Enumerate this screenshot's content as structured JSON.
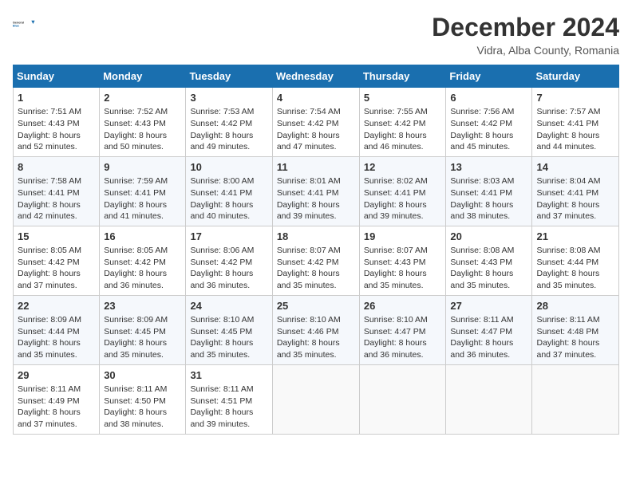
{
  "header": {
    "logo_general": "General",
    "logo_blue": "Blue",
    "main_title": "December 2024",
    "subtitle": "Vidra, Alba County, Romania"
  },
  "calendar": {
    "days": [
      "Sunday",
      "Monday",
      "Tuesday",
      "Wednesday",
      "Thursday",
      "Friday",
      "Saturday"
    ],
    "rows": [
      [
        {
          "day": "1",
          "sunrise": "7:51 AM",
          "sunset": "4:43 PM",
          "daylight": "8 hours and 52 minutes."
        },
        {
          "day": "2",
          "sunrise": "7:52 AM",
          "sunset": "4:43 PM",
          "daylight": "8 hours and 50 minutes."
        },
        {
          "day": "3",
          "sunrise": "7:53 AM",
          "sunset": "4:42 PM",
          "daylight": "8 hours and 49 minutes."
        },
        {
          "day": "4",
          "sunrise": "7:54 AM",
          "sunset": "4:42 PM",
          "daylight": "8 hours and 47 minutes."
        },
        {
          "day": "5",
          "sunrise": "7:55 AM",
          "sunset": "4:42 PM",
          "daylight": "8 hours and 46 minutes."
        },
        {
          "day": "6",
          "sunrise": "7:56 AM",
          "sunset": "4:42 PM",
          "daylight": "8 hours and 45 minutes."
        },
        {
          "day": "7",
          "sunrise": "7:57 AM",
          "sunset": "4:41 PM",
          "daylight": "8 hours and 44 minutes."
        }
      ],
      [
        {
          "day": "8",
          "sunrise": "7:58 AM",
          "sunset": "4:41 PM",
          "daylight": "8 hours and 42 minutes."
        },
        {
          "day": "9",
          "sunrise": "7:59 AM",
          "sunset": "4:41 PM",
          "daylight": "8 hours and 41 minutes."
        },
        {
          "day": "10",
          "sunrise": "8:00 AM",
          "sunset": "4:41 PM",
          "daylight": "8 hours and 40 minutes."
        },
        {
          "day": "11",
          "sunrise": "8:01 AM",
          "sunset": "4:41 PM",
          "daylight": "8 hours and 39 minutes."
        },
        {
          "day": "12",
          "sunrise": "8:02 AM",
          "sunset": "4:41 PM",
          "daylight": "8 hours and 39 minutes."
        },
        {
          "day": "13",
          "sunrise": "8:03 AM",
          "sunset": "4:41 PM",
          "daylight": "8 hours and 38 minutes."
        },
        {
          "day": "14",
          "sunrise": "8:04 AM",
          "sunset": "4:41 PM",
          "daylight": "8 hours and 37 minutes."
        }
      ],
      [
        {
          "day": "15",
          "sunrise": "8:05 AM",
          "sunset": "4:42 PM",
          "daylight": "8 hours and 37 minutes."
        },
        {
          "day": "16",
          "sunrise": "8:05 AM",
          "sunset": "4:42 PM",
          "daylight": "8 hours and 36 minutes."
        },
        {
          "day": "17",
          "sunrise": "8:06 AM",
          "sunset": "4:42 PM",
          "daylight": "8 hours and 36 minutes."
        },
        {
          "day": "18",
          "sunrise": "8:07 AM",
          "sunset": "4:42 PM",
          "daylight": "8 hours and 35 minutes."
        },
        {
          "day": "19",
          "sunrise": "8:07 AM",
          "sunset": "4:43 PM",
          "daylight": "8 hours and 35 minutes."
        },
        {
          "day": "20",
          "sunrise": "8:08 AM",
          "sunset": "4:43 PM",
          "daylight": "8 hours and 35 minutes."
        },
        {
          "day": "21",
          "sunrise": "8:08 AM",
          "sunset": "4:44 PM",
          "daylight": "8 hours and 35 minutes."
        }
      ],
      [
        {
          "day": "22",
          "sunrise": "8:09 AM",
          "sunset": "4:44 PM",
          "daylight": "8 hours and 35 minutes."
        },
        {
          "day": "23",
          "sunrise": "8:09 AM",
          "sunset": "4:45 PM",
          "daylight": "8 hours and 35 minutes."
        },
        {
          "day": "24",
          "sunrise": "8:10 AM",
          "sunset": "4:45 PM",
          "daylight": "8 hours and 35 minutes."
        },
        {
          "day": "25",
          "sunrise": "8:10 AM",
          "sunset": "4:46 PM",
          "daylight": "8 hours and 35 minutes."
        },
        {
          "day": "26",
          "sunrise": "8:10 AM",
          "sunset": "4:47 PM",
          "daylight": "8 hours and 36 minutes."
        },
        {
          "day": "27",
          "sunrise": "8:11 AM",
          "sunset": "4:47 PM",
          "daylight": "8 hours and 36 minutes."
        },
        {
          "day": "28",
          "sunrise": "8:11 AM",
          "sunset": "4:48 PM",
          "daylight": "8 hours and 37 minutes."
        }
      ],
      [
        {
          "day": "29",
          "sunrise": "8:11 AM",
          "sunset": "4:49 PM",
          "daylight": "8 hours and 37 minutes."
        },
        {
          "day": "30",
          "sunrise": "8:11 AM",
          "sunset": "4:50 PM",
          "daylight": "8 hours and 38 minutes."
        },
        {
          "day": "31",
          "sunrise": "8:11 AM",
          "sunset": "4:51 PM",
          "daylight": "8 hours and 39 minutes."
        },
        null,
        null,
        null,
        null
      ]
    ]
  }
}
